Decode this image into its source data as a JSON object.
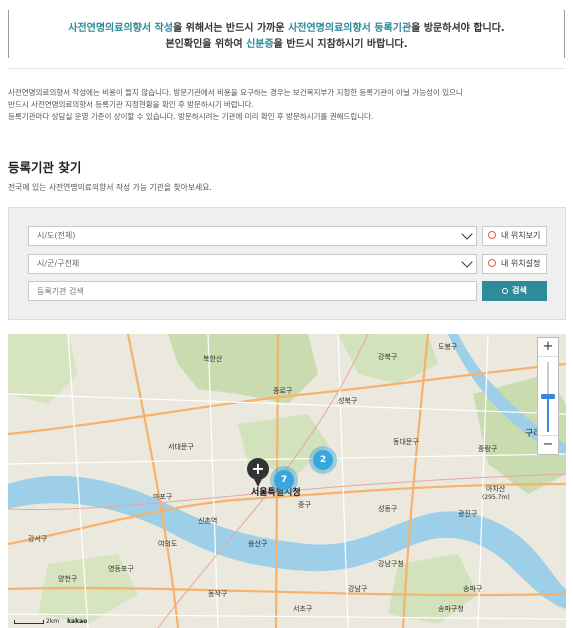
{
  "notice": {
    "line1_a": "사전연명의료의향서 작성",
    "line1_b": "을 위해서는 반드시 가까운 ",
    "line1_c": "사전연명의료의향서 등록기관",
    "line1_d": "을 방문하셔야 합니다.",
    "line2_a": "본인확인을 위하여 ",
    "line2_b": "신분증",
    "line2_c": "을 반드시 지참하시기 바랍니다."
  },
  "info": {
    "line1": "사전연명의료의향서 작성에는 비용이 들지 않습니다. 방문기관에서 비용을 요구하는 경우는 보건복지부가 지정한 등록기관이 아닐 가능성이 있으니",
    "line2": "반드시 사전연명의료의향서 등록기관 지정현황을 확인 후 방문하시기 바랍니다.",
    "line3": "등록기관마다 상담실 운영 기준이 상이할 수 있습니다. 방문하시려는 기관에 미리 확인 후 방문하시기를 권해드립니다."
  },
  "section": {
    "title": "등록기관 찾기",
    "subtitle": "전국에 있는 사전연명의료의향서 작성 가능 기관을 찾아보세요."
  },
  "search": {
    "sido_selected": "시/도(전체)",
    "sigungu_selected": "시/군/구전체",
    "keyword_placeholder": "등록기관 검색",
    "my_location_view": "내 위치보기",
    "my_location_set": "내 위치설정",
    "search_button": "검색"
  },
  "map": {
    "attribution": "kakao",
    "scale": "2km",
    "clusters": [
      {
        "count": "2",
        "color": "#3aa6dc"
      },
      {
        "count": "7",
        "color": "#3aa6dc"
      }
    ],
    "labels": {
      "city_hall": "서울특별시청",
      "guri": "구리",
      "jongno": "종로구",
      "junggu": "중구",
      "mapo": "마포구",
      "seodaemun": "서대문구",
      "dongdaemun": "동대문구",
      "seongdong": "성동구",
      "yongsan": "용산구",
      "gwangjin": "광진구",
      "yeongdeungpo": "영등포구",
      "seongbuk": "성북구",
      "gangbuk": "강북구",
      "dobong": "도봉구",
      "jungnang": "중랑구",
      "achasan": "아차산",
      "achasan_height": "(295.7m)",
      "sinchon": "신촌역",
      "yangcheon": "양천구",
      "gangseo": "강서구",
      "dongjak": "동작구",
      "gangnam": "강남구",
      "songpa": "송파구",
      "seocho": "서초구",
      "bukhansan": "북한산",
      "gangnamgu_office": "강남구청",
      "songpa_market": "송파구청",
      "yeouido": "여의도"
    }
  },
  "colors": {
    "accent": "#2a8a9a",
    "search_btn": "#2f8a9a",
    "location_ring": "#e05a4a",
    "zoom_blue": "#3a87e0"
  }
}
